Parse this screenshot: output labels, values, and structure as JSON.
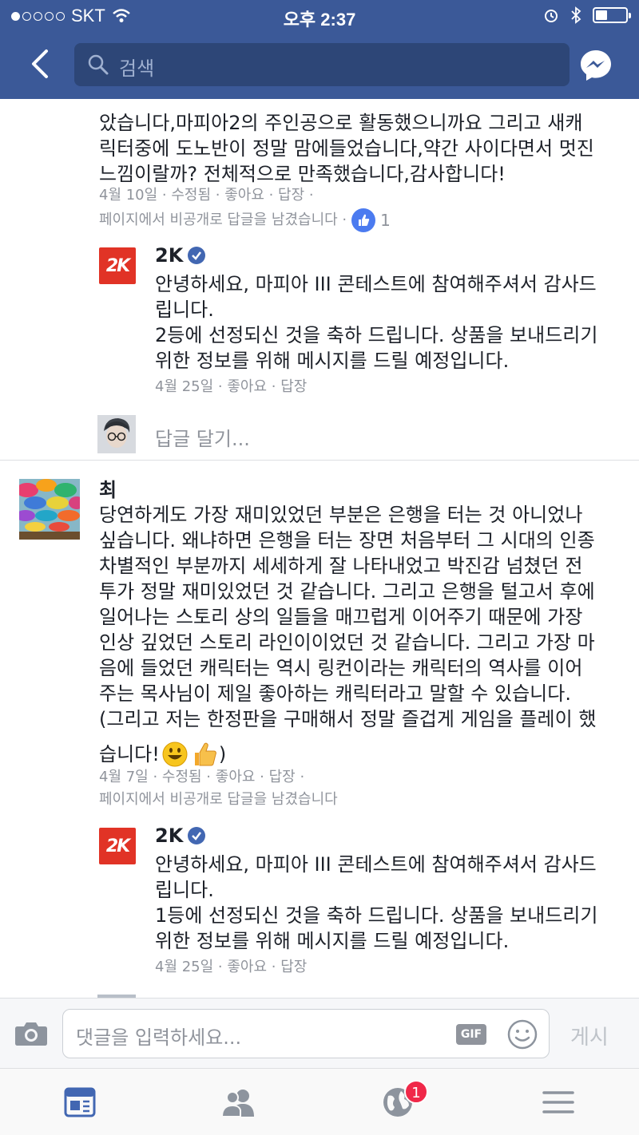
{
  "status_bar": {
    "carrier": "SKT",
    "time": "오후 2:37"
  },
  "nav": {
    "search_placeholder": "검색"
  },
  "comments": [
    {
      "text_lines": [
        "았습니다,마피아2의 주인공으로 활동했으니까요 그리고 새캐",
        "릭터중에 도노반이 정말 맘에들었습니다,약간 사이다면서 멋진",
        "느낌이랄까? 전체적으로 만족했습니다,감사합니다!"
      ],
      "meta_line1": "4월 10일 · 수정됨 · 좋아요 · 답장 ·",
      "meta_line2": "페이지에서 비공개로 답글을 남겼습니다 ·",
      "like_count": "1",
      "reply": {
        "name": "2K",
        "text_lines": [
          "안녕하세요, 마피아 III 콘테스트에 참여해주셔서 감사드",
          "립니다.",
          "2등에 선정되신 것을 축하 드립니다. 상품을 보내드리기",
          "위한 정보를 위해  메시지를 드릴 예정입니다."
        ],
        "meta": "4월 25일 · 좋아요 · 답장"
      },
      "reply_placeholder": "답글 달기..."
    },
    {
      "name": "최",
      "text_lines": [
        "당연하게도 가장 재미있었던 부분은 은행을 터는 것 아니었나",
        "싶습니다. 왜냐하면 은행을 터는 장면 처음부터 그 시대의 인종",
        "차별적인 부분까지 세세하게 잘 나타내었고 박진감 넘쳤던 전",
        "투가 정말 재미있었던 것 같습니다. 그리고 은행을 털고서 후에",
        "일어나는 스토리 상의 일들을 매끄럽게 이어주기 때문에 가장",
        "인상 깊었던 스토리 라인이이었던 것 같습니다. 그리고 가장 마",
        "음에 들었던 캐릭터는 역시 링컨이라는 캐릭터의 역사를 이어",
        "주는 목사님이 제일 좋아하는 캐릭터라고 말할 수 있습니다.",
        "(그리고 저는 한정판을 구매해서 정말 즐겁게 게임을 플레이 했"
      ],
      "last_line": "습니다!",
      "last_line_end": ")",
      "meta_line1": "4월 7일 · 수정됨 · 좋아요 · 답장 ·",
      "meta_line2": "페이지에서 비공개로 답글을 남겼습니다",
      "reply": {
        "name": "2K",
        "text_lines": [
          "안녕하세요, 마피아 III 콘테스트에 참여해주셔서 감사드",
          "립니다.",
          "1등에 선정되신 것을 축하 드립니다. 상품을 보내드리기",
          "위한 정보를 위해  메시지를 드릴 예정입니다."
        ],
        "meta": "4월 25일 · 좋아요 · 답장"
      }
    }
  ],
  "logo_text": "2K",
  "input": {
    "placeholder": "댓글을 입력하세요...",
    "gif_label": "GIF",
    "post_label": "게시"
  },
  "tabs": {
    "notification_count": "1"
  },
  "colors": {
    "brand": "#3b5998",
    "logo": "#e13326",
    "badge": "#f02849"
  }
}
